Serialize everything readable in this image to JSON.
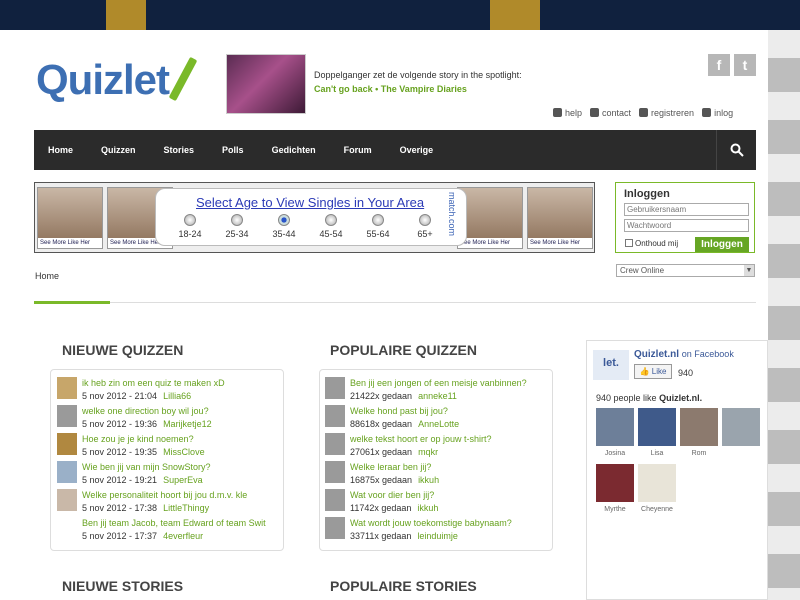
{
  "header": {
    "logo": "Quizlet",
    "spotlight_text": "Doppelganger zet de volgende story in the spotlight:",
    "spotlight_link": "Can't go back • The Vampire Diaries",
    "social": [
      "f",
      "t"
    ],
    "user_links": [
      "help",
      "contact",
      "registreren",
      "inlog"
    ]
  },
  "nav": {
    "items": [
      "Home",
      "Quizzen",
      "Stories",
      "Polls",
      "Gedichten",
      "Forum",
      "Overige"
    ],
    "search_icon": "search-icon"
  },
  "ad": {
    "title": "Select Age to View Singles in Your Area",
    "ages": [
      "18-24",
      "25-34",
      "35-44",
      "45-54",
      "55-64",
      "65+"
    ],
    "selected": "35-44",
    "brand": "match.com",
    "caption": "See More Like Her"
  },
  "login": {
    "title": "Inloggen",
    "username_placeholder": "Gebruikersnaam",
    "password_placeholder": "Wachtwoord",
    "remember": "Onthoud mij",
    "button": "Inloggen"
  },
  "crew": "Crew Online",
  "breadcrumb": "Home",
  "sections": {
    "new_quizzes": "NIEUWE QUIZZEN",
    "popular_quizzes": "POPULAIRE QUIZZEN",
    "new_stories": "NIEUWE STORIES",
    "popular_stories": "POPULAIRE STORIES"
  },
  "new_quizzes": [
    {
      "title": "ik heb zin om een quiz te maken xD",
      "date": "5 nov 2012 - 21:04",
      "user": "Lillia66"
    },
    {
      "title": "welke one direction boy wil jou?",
      "date": "5 nov 2012 - 19:36",
      "user": "Marijketje12"
    },
    {
      "title": "Hoe zou je je kind noemen?",
      "date": "5 nov 2012 - 19:35",
      "user": "MissClove"
    },
    {
      "title": "Wie ben jij van mijn SnowStory?",
      "date": "5 nov 2012 - 19:21",
      "user": "SuperEva"
    },
    {
      "title": "Welke personaliteit hoort bij jou d.m.v. kle",
      "date": "5 nov 2012 - 17:38",
      "user": "LittleThingy"
    },
    {
      "title": "Ben jij team Jacob, team Edward of team Swit",
      "date": "5 nov 2012 - 17:37",
      "user": "4everfleur"
    }
  ],
  "popular_quizzes": [
    {
      "title": "Ben jij een jongen of een meisje vanbinnen?",
      "stat": "21422x gedaan",
      "user": "anneke11"
    },
    {
      "title": "Welke hond past bij jou?",
      "stat": "88618x gedaan",
      "user": "AnneLotte"
    },
    {
      "title": "welke tekst hoort er op jouw t-shirt?",
      "stat": "27061x gedaan",
      "user": "mqkr"
    },
    {
      "title": "Welke leraar ben jij?",
      "stat": "16875x gedaan",
      "user": "ikkuh"
    },
    {
      "title": "Wat voor dier ben jij?",
      "stat": "11742x gedaan",
      "user": "ikkuh"
    },
    {
      "title": "Wat wordt jouw toekomstige babynaam?",
      "stat": "33711x gedaan",
      "user": "leinduimje"
    }
  ],
  "facebook": {
    "logo": "let.",
    "page": "Quizlet.nl",
    "on": "on Facebook",
    "like": "Like",
    "count": "940",
    "people_prefix": "940 people like",
    "people_page": "Quizlet.nl.",
    "people": [
      "Josina",
      "Lisa",
      "Rom",
      "",
      "Myrthe",
      "Cheyenne"
    ]
  }
}
